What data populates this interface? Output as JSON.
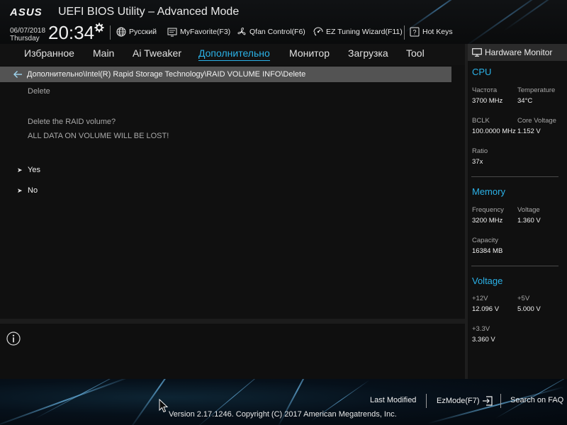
{
  "header": {
    "logo_text": "ASUS",
    "title": "UEFI BIOS Utility – Advanced Mode",
    "date": "06/07/2018",
    "day": "Thursday",
    "time": "20:34",
    "tools": [
      {
        "label": "Русский",
        "icon": "globe-icon"
      },
      {
        "label": "MyFavorite(F3)",
        "icon": "favorite-icon"
      },
      {
        "label": "Qfan Control(F6)",
        "icon": "fan-icon"
      },
      {
        "label": "EZ Tuning Wizard(F11)",
        "icon": "wizard-icon"
      },
      {
        "label": "Hot Keys",
        "icon": "hotkeys-icon"
      }
    ]
  },
  "nav": {
    "tabs": [
      {
        "label": "Избранное",
        "active": false
      },
      {
        "label": "Main",
        "active": false
      },
      {
        "label": "Ai Tweaker",
        "active": false
      },
      {
        "label": "Дополнительно",
        "active": true
      },
      {
        "label": "Монитор",
        "active": false
      },
      {
        "label": "Загрузка",
        "active": false
      },
      {
        "label": "Tool",
        "active": false
      }
    ]
  },
  "main": {
    "breadcrumb": "Дополнительно\\Intel(R) Rapid Storage Technology\\RAID VOLUME INFO\\Delete",
    "heading": "Delete",
    "message_line1": "Delete the RAID volume?",
    "message_line2": "ALL DATA ON VOLUME WILL BE LOST!",
    "options": [
      {
        "label": "Yes"
      },
      {
        "label": "No"
      }
    ]
  },
  "hardware_monitor": {
    "title": "Hardware Monitor",
    "cpu": {
      "section": "CPU",
      "freq_label": "Частота",
      "freq_value": "3700 MHz",
      "temp_label": "Temperature",
      "temp_value": "34°C",
      "bclk_label": "BCLK",
      "bclk_value": "100.0000 MHz",
      "vcore_label": "Core Voltage",
      "vcore_value": "1.152 V",
      "ratio_label": "Ratio",
      "ratio_value": "37x"
    },
    "memory": {
      "section": "Memory",
      "freq_label": "Frequency",
      "freq_value": "3200 MHz",
      "volt_label": "Voltage",
      "volt_value": "1.360 V",
      "cap_label": "Capacity",
      "cap_value": "16384 MB"
    },
    "voltage": {
      "section": "Voltage",
      "v12_label": "+12V",
      "v12_value": "12.096 V",
      "v5_label": "+5V",
      "v5_value": "5.000 V",
      "v33_label": "+3.3V",
      "v33_value": "3.360 V"
    }
  },
  "footer": {
    "last_modified": "Last Modified",
    "ezmode": "EzMode(F7)",
    "search_faq": "Search on FAQ",
    "copyright": "Version 2.17.1246. Copyright (C) 2017 American Megatrends, Inc."
  },
  "colors": {
    "accent": "#2bb2e8",
    "breadcrumb_bg": "#535353",
    "panel_bg": "#101010"
  }
}
